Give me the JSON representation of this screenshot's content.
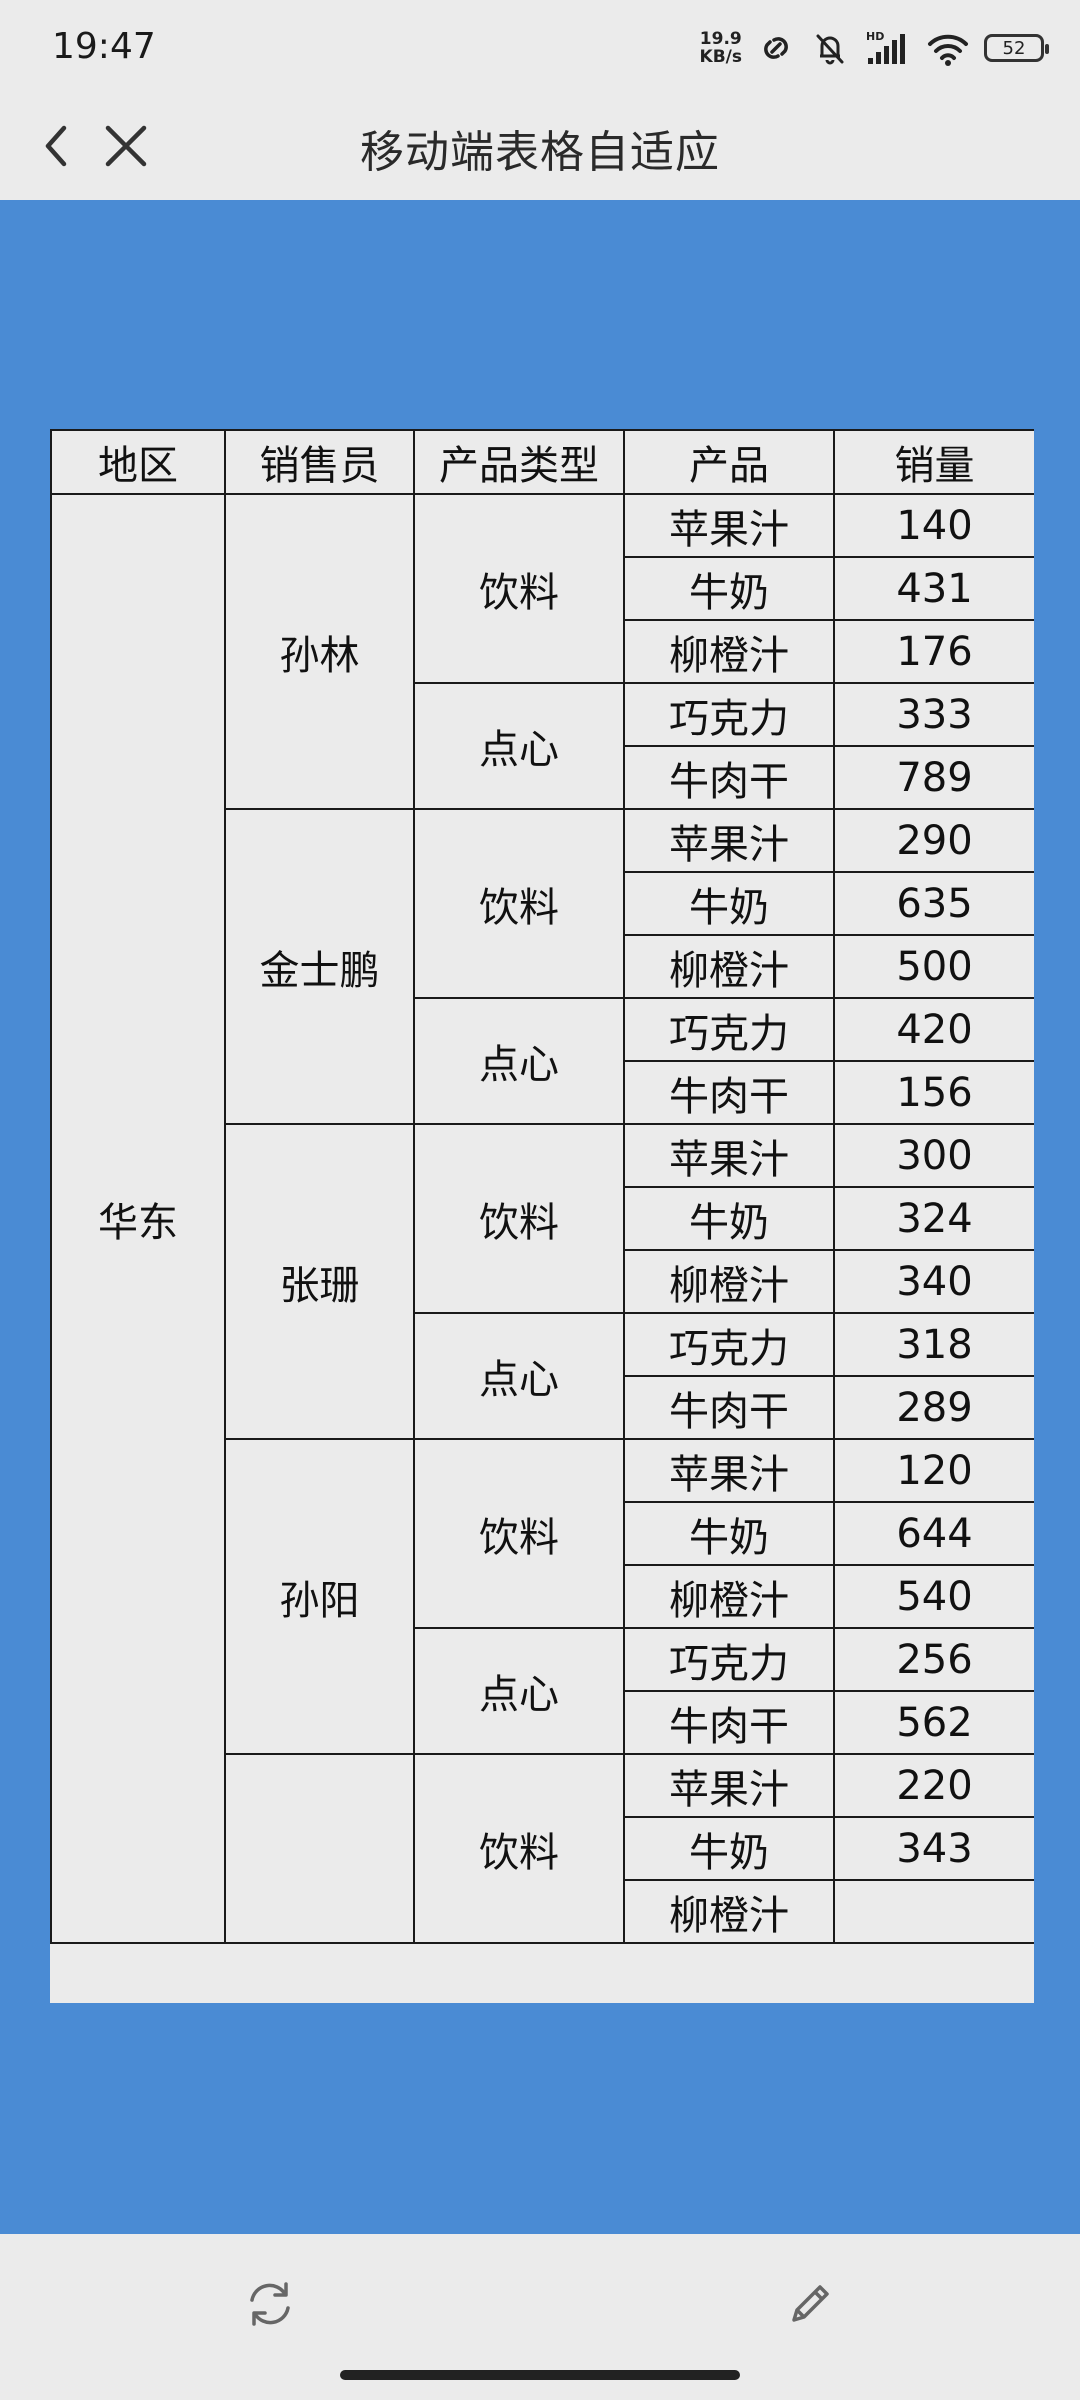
{
  "status_bar": {
    "time": "19:47",
    "net_speed_value": "19.9",
    "net_speed_unit": "KB/s",
    "battery_level": "52",
    "icons": [
      "link-icon",
      "mute-bell-icon",
      "hd-signal-icon",
      "wifi-icon",
      "battery-icon"
    ]
  },
  "nav": {
    "title": "移动端表格自适应",
    "back_icon": "chevron-left-icon",
    "close_icon": "close-icon"
  },
  "table": {
    "headers": [
      "地区",
      "销售员",
      "产品类型",
      "产品",
      "销量"
    ],
    "region": "华东",
    "salespeople": [
      {
        "name": "孙林",
        "groups": [
          {
            "type": "饮料",
            "items": [
              {
                "product": "苹果汁",
                "qty": "140"
              },
              {
                "product": "牛奶",
                "qty": "431"
              },
              {
                "product": "柳橙汁",
                "qty": "176"
              }
            ]
          },
          {
            "type": "点心",
            "items": [
              {
                "product": "巧克力",
                "qty": "333"
              },
              {
                "product": "牛肉干",
                "qty": "789"
              }
            ]
          }
        ]
      },
      {
        "name": "金士鹏",
        "groups": [
          {
            "type": "饮料",
            "items": [
              {
                "product": "苹果汁",
                "qty": "290"
              },
              {
                "product": "牛奶",
                "qty": "635"
              },
              {
                "product": "柳橙汁",
                "qty": "500"
              }
            ]
          },
          {
            "type": "点心",
            "items": [
              {
                "product": "巧克力",
                "qty": "420"
              },
              {
                "product": "牛肉干",
                "qty": "156"
              }
            ]
          }
        ]
      },
      {
        "name": "张珊",
        "groups": [
          {
            "type": "饮料",
            "items": [
              {
                "product": "苹果汁",
                "qty": "300"
              },
              {
                "product": "牛奶",
                "qty": "324"
              },
              {
                "product": "柳橙汁",
                "qty": "340"
              }
            ]
          },
          {
            "type": "点心",
            "items": [
              {
                "product": "巧克力",
                "qty": "318"
              },
              {
                "product": "牛肉干",
                "qty": "289"
              }
            ]
          }
        ]
      },
      {
        "name": "孙阳",
        "groups": [
          {
            "type": "饮料",
            "items": [
              {
                "product": "苹果汁",
                "qty": "120"
              },
              {
                "product": "牛奶",
                "qty": "644"
              },
              {
                "product": "柳橙汁",
                "qty": "540"
              }
            ]
          },
          {
            "type": "点心",
            "items": [
              {
                "product": "巧克力",
                "qty": "256"
              },
              {
                "product": "牛肉干",
                "qty": "562"
              }
            ]
          }
        ]
      },
      {
        "name": "",
        "groups": [
          {
            "type": "饮料",
            "items": [
              {
                "product": "苹果汁",
                "qty": "220"
              },
              {
                "product": "牛奶",
                "qty": "343"
              },
              {
                "product": "柳橙汁",
                "qty": ""
              }
            ]
          }
        ]
      }
    ]
  },
  "toolbar": {
    "refresh_icon": "refresh-icon",
    "edit_icon": "pencil-icon"
  }
}
